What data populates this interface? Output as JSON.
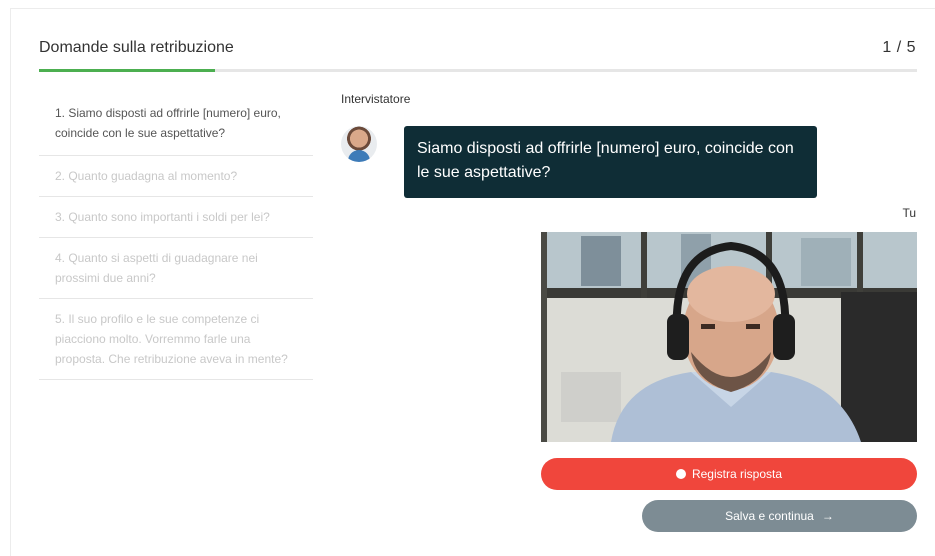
{
  "header": {
    "title": "Domande sulla retribuzione",
    "counter": "1 / 5",
    "progress_fraction": 0.2,
    "accent_color": "#4caf50"
  },
  "questions": [
    {
      "label": "1. Siamo disposti ad offrirle [numero] euro, coincide con le sue aspettative?",
      "active": true
    },
    {
      "label": "2. Quanto guadagna al momento?",
      "active": false
    },
    {
      "label": "3. Quanto sono importanti i soldi per lei?",
      "active": false
    },
    {
      "label": "4. Quanto si aspetti di guadagnare nei prossimi due anni?",
      "active": false
    },
    {
      "label": "5. Il suo profilo e le sue competenze ci piacciono molto. Vorremmo farle una proposta. Che retribuzione aveva in mente?",
      "active": false
    }
  ],
  "chat": {
    "interviewer_label": "Intervistatore",
    "interviewer_message": "Siamo disposti ad offrirle [numero] euro, coincide con le sue aspettative?",
    "bubble_color": "#0f2d36",
    "you_label": "Tu"
  },
  "actions": {
    "record_label": "Registra risposta",
    "record_color": "#f0463c",
    "save_label": "Salva e continua",
    "save_icon": "arrow-right-icon",
    "save_color": "#7d8c94"
  }
}
